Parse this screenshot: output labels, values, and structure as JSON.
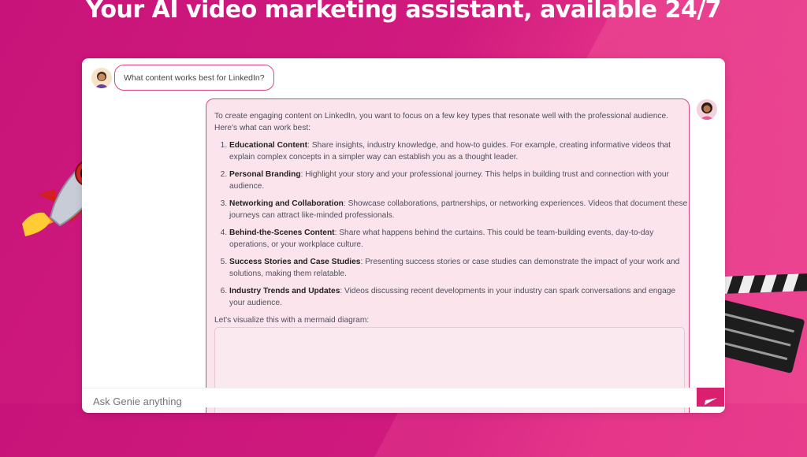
{
  "headline": "Your AI video marketing assistant, available 24/7",
  "chat": {
    "user_message": "What content works best for LinkedIn?",
    "genie_intro": "To create engaging content on LinkedIn, you want to focus on a few key types that resonate well with the professional audience. Here's what can work best:",
    "items": [
      {
        "title": "Educational Content",
        "text": ": Share insights, industry knowledge, and how-to guides. For example, creating informative videos that explain complex concepts in a simpler way can establish you as a thought leader."
      },
      {
        "title": "Personal Branding",
        "text": ": Highlight your story and your professional journey. This helps in building trust and connection with your audience."
      },
      {
        "title": "Networking and Collaboration",
        "text": ": Showcase collaborations, partnerships, or networking experiences. Videos that document these journeys can attract like-minded professionals."
      },
      {
        "title": "Behind-the-Scenes Content",
        "text": ": Share what happens behind the curtains. This could be team-building events, day-to-day operations, or your workplace culture."
      },
      {
        "title": "Success Stories and Case Studies",
        "text": ": Presenting success stories or case studies can demonstrate the impact of your work and solutions, making them relatable."
      },
      {
        "title": "Industry Trends and Updates",
        "text": ": Videos discussing recent developments in your industry can spark conversations and engage your audience."
      }
    ],
    "diagram_intro": "Let's visualize this with a mermaid diagram:"
  },
  "input": {
    "placeholder": "Ask Genie anything"
  },
  "icons": {
    "send": "send-icon",
    "rocket": "rocket-icon",
    "clapper": "clapperboard-icon"
  },
  "colors": {
    "accent": "#d9206f",
    "bubble_border": "#d9467f",
    "genie_bubble_bg": "#fbe4ec"
  }
}
